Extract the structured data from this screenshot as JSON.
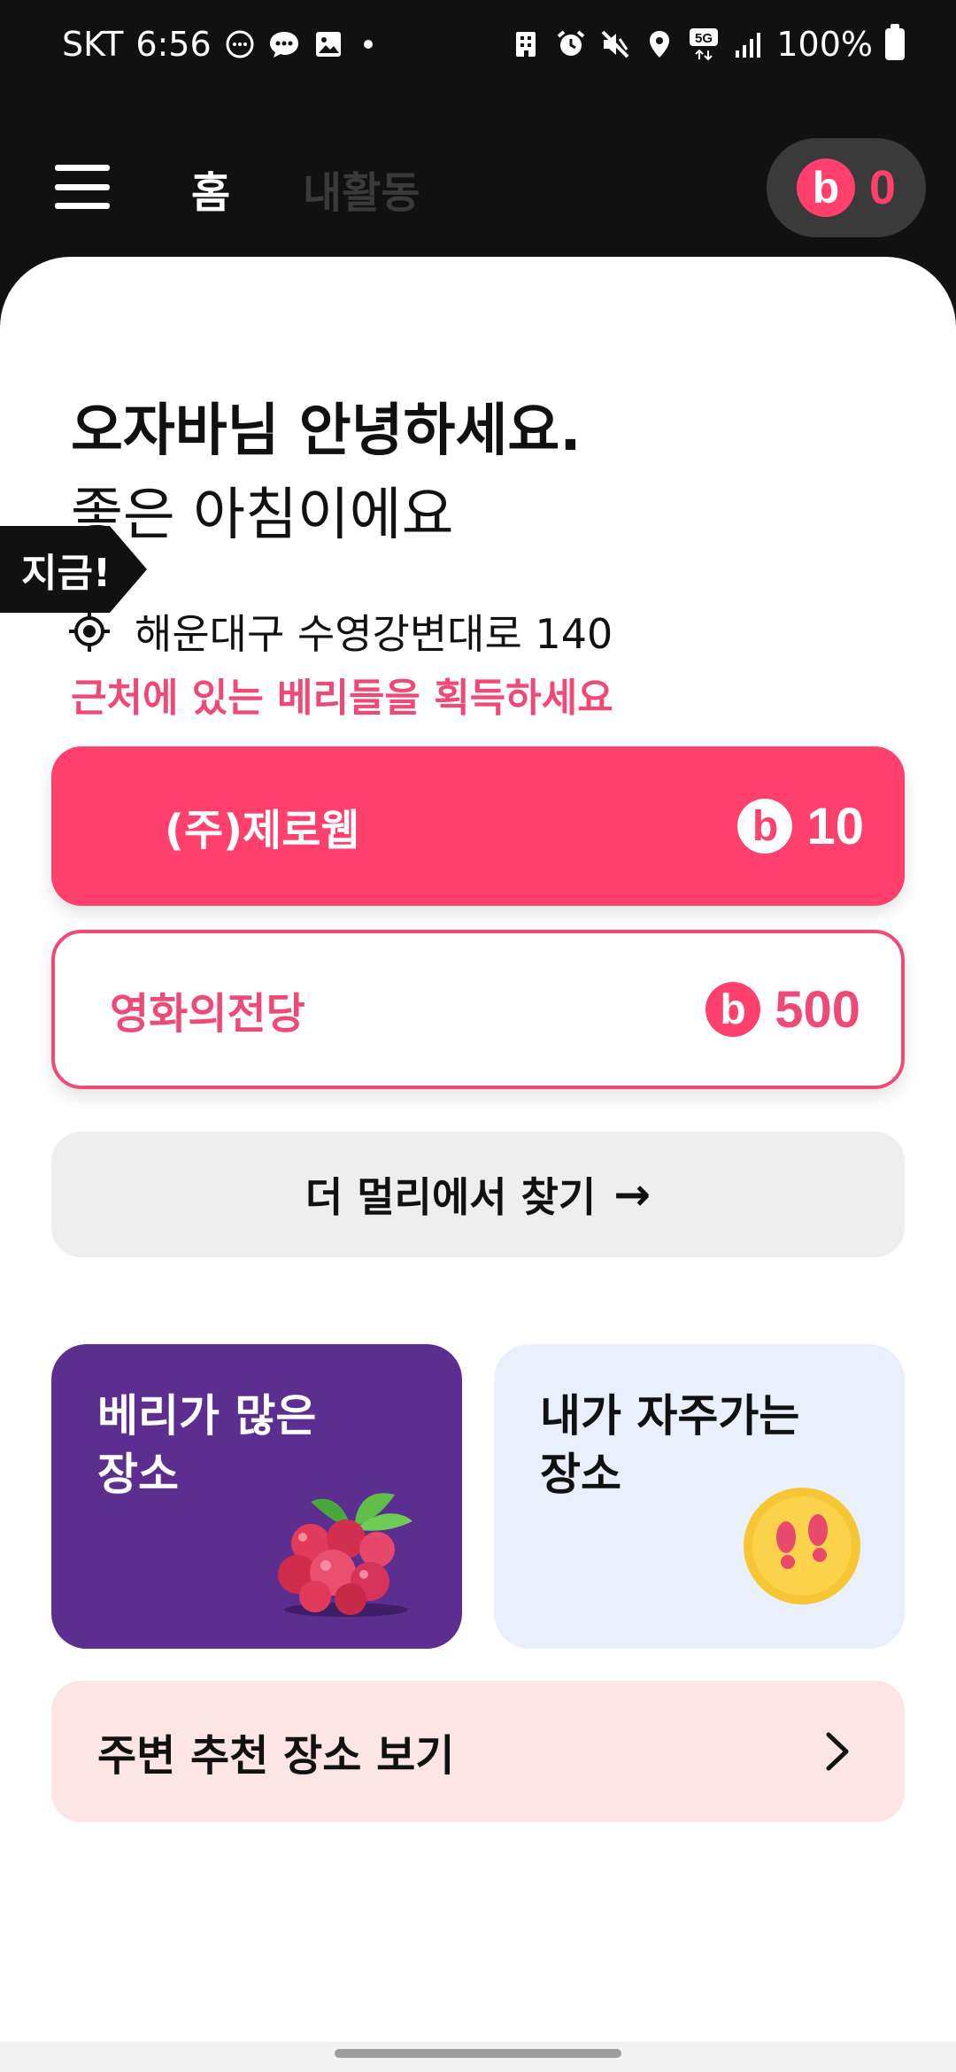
{
  "status_bar": {
    "carrier": "SKT",
    "time": "6:56",
    "network": "5G",
    "battery": "100%",
    "left_icons": [
      "chat-bubble-icon",
      "message-icon",
      "image-icon"
    ],
    "right_icons": [
      "building-icon",
      "alarm-icon",
      "mute-icon",
      "location-icon",
      "network-5g-icon",
      "signal-icon",
      "battery-icon"
    ]
  },
  "app_bar": {
    "tabs": [
      {
        "label": "홈",
        "active": true
      },
      {
        "label": "내활동",
        "active": false
      }
    ],
    "berry_logo": "b",
    "berry_balance": "0"
  },
  "greeting": {
    "title": "오자바님 안녕하세요.",
    "subtitle": "좋은 아침이에요"
  },
  "location": {
    "address": "해운대구 수영강변대로 140",
    "hint": "근처에 있는 베리들을 획득하세요"
  },
  "places": [
    {
      "tag": "지금!",
      "name": "(주)제로웹",
      "reward": "10",
      "logo": "b"
    },
    {
      "name": "영화의전당",
      "reward": "500",
      "logo": "b"
    }
  ],
  "find_farther": {
    "label": "더 멀리에서 찾기",
    "arrow": "→"
  },
  "tiles": [
    {
      "title": "베리가 많은\n장소",
      "icon": "berries-icon"
    },
    {
      "title": "내가 자주가는\n장소",
      "icon": "footprints-icon"
    }
  ],
  "recommend": {
    "label": "주변 추천 장소 보기",
    "icon": "chevron-right-icon"
  },
  "colors": {
    "brand_pink": "#ff3f6c",
    "text_pink": "#ef4a76",
    "purple": "#5b2e8f",
    "light_blue": "#eaf0fb",
    "light_pink": "#fde5e5",
    "dark": "#111111"
  }
}
